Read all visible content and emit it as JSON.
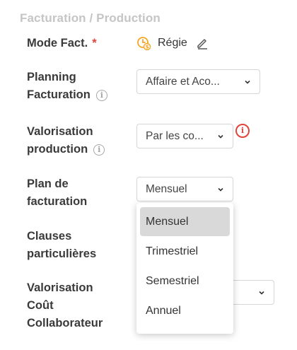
{
  "section_title": "Facturation / Production",
  "mode_fact": {
    "label": "Mode Fact.",
    "required_mark": "*",
    "value": "Régie"
  },
  "planning_facturation": {
    "label_line1": "Planning",
    "label_line2": "Facturation",
    "value": "Affaire et Aco..."
  },
  "valorisation_production": {
    "label_line1": "Valorisation",
    "label_line2": "production",
    "value": "Par les co..."
  },
  "plan_facturation": {
    "label_line1": "Plan de",
    "label_line2": "facturation",
    "value": "Mensuel",
    "options": [
      "Mensuel",
      "Trimestriel",
      "Semestriel",
      "Annuel"
    ],
    "selected_index": 0
  },
  "clauses": {
    "label_line1": "Clauses",
    "label_line2": "particulières"
  },
  "valorisation_cout": {
    "label_line1": "Valorisation",
    "label_line2": "Coût",
    "label_line3": "Collaborateur"
  },
  "colors": {
    "required": "#e0453c",
    "accent_orange": "#f5a623",
    "alert": "#e0453c"
  }
}
